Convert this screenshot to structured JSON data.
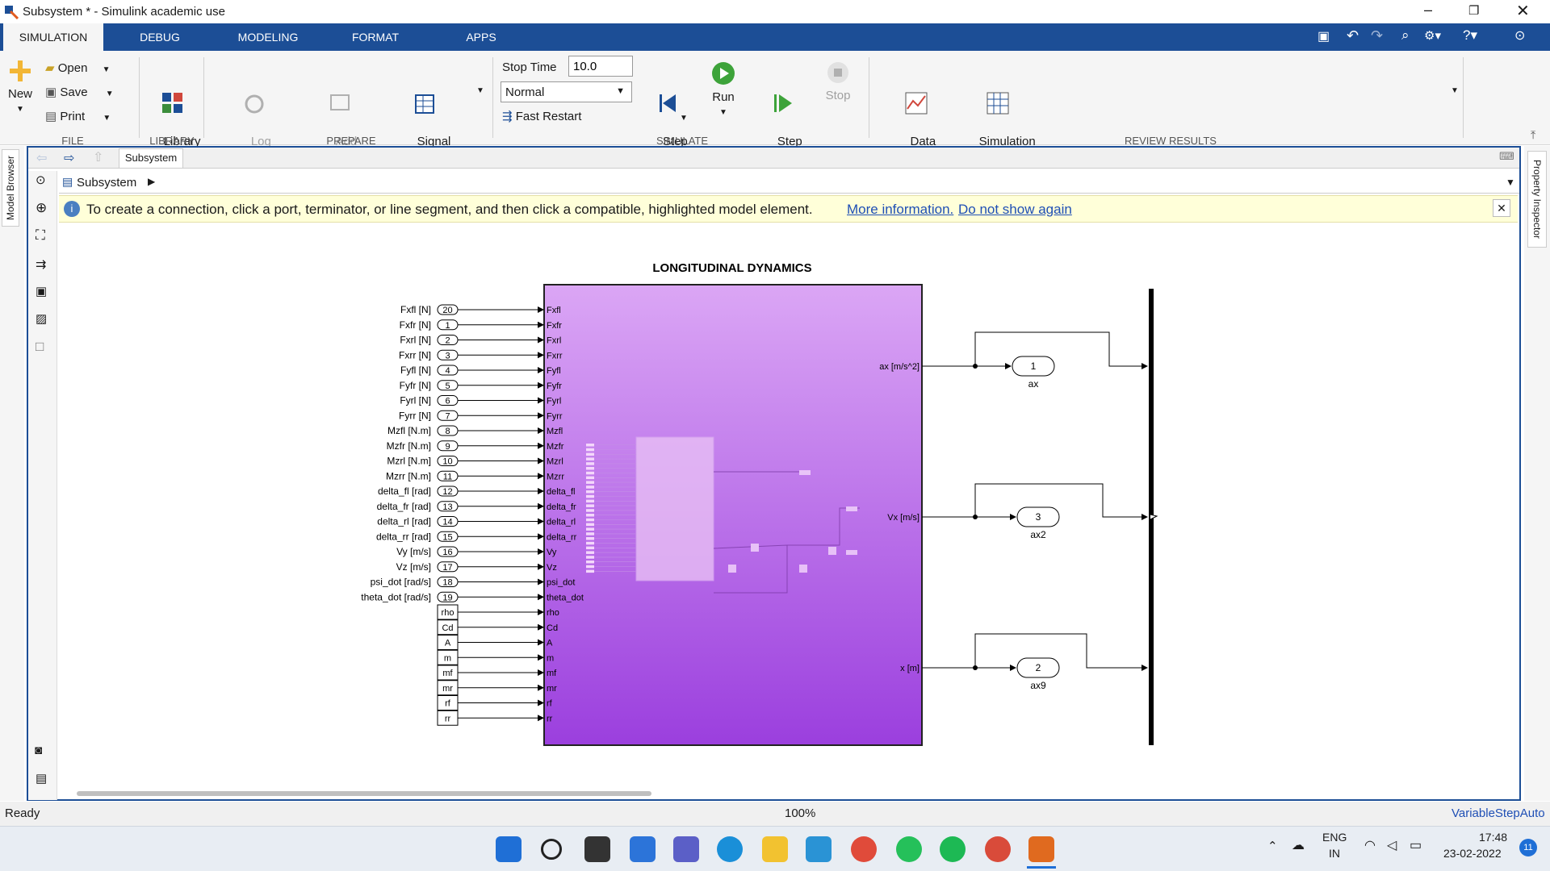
{
  "window": {
    "title": "Subsystem * - Simulink academic use"
  },
  "tabs": [
    "SIMULATION",
    "DEBUG",
    "MODELING",
    "FORMAT",
    "APPS"
  ],
  "ribbon": {
    "new": "New",
    "open": "Open",
    "save": "Save",
    "print": "Print",
    "library": "Library\nBrowser",
    "log_signals": "Log\nSignals",
    "add_viewer": "Add\nViewer",
    "signal_table": "Signal\nTable",
    "stop_time_label": "Stop Time",
    "stop_time_value": "10.0",
    "sim_mode": "Normal",
    "fast_restart": "Fast Restart",
    "step_back": "Step\nBack",
    "run": "Run",
    "step_forward": "Step\nForward",
    "stop": "Stop",
    "data_inspector": "Data\nInspector",
    "sim_manager": "Simulation\nManager",
    "groups": {
      "file": "FILE",
      "library": "LIBRARY",
      "prepare": "PREPARE",
      "simulate": "SIMULATE",
      "review": "REVIEW RESULTS"
    }
  },
  "editor": {
    "model_browser": "Model Browser",
    "property_inspector": "Property Inspector",
    "tab": "Subsystem",
    "address": "Subsystem",
    "info_text": "To create a connection, click a port, terminator, or line segment, and then click a compatible, highlighted model element.",
    "info_more": "More information.",
    "info_dismiss": "Do not show again"
  },
  "diagram": {
    "subsystem_title": "LONGITUDINAL DYNAMICS",
    "inputs": [
      {
        "label": "Fxfl [N]",
        "num": "20",
        "port": "Fxfl"
      },
      {
        "label": "Fxfr [N]",
        "num": "1",
        "port": "Fxfr"
      },
      {
        "label": "Fxrl [N]",
        "num": "2",
        "port": "Fxrl"
      },
      {
        "label": "Fxrr [N]",
        "num": "3",
        "port": "Fxrr"
      },
      {
        "label": "Fyfl [N]",
        "num": "4",
        "port": "Fyfl"
      },
      {
        "label": "Fyfr [N]",
        "num": "5",
        "port": "Fyfr"
      },
      {
        "label": "Fyrl [N]",
        "num": "6",
        "port": "Fyrl"
      },
      {
        "label": "Fyrr [N]",
        "num": "7",
        "port": "Fyrr"
      },
      {
        "label": "Mzfl [N.m]",
        "num": "8",
        "port": "Mzfl"
      },
      {
        "label": "Mzfr [N.m]",
        "num": "9",
        "port": "Mzfr"
      },
      {
        "label": "Mzrl [N.m]",
        "num": "10",
        "port": "Mzrl"
      },
      {
        "label": "Mzrr [N.m]",
        "num": "11",
        "port": "Mzrr"
      },
      {
        "label": "delta_fl [rad]",
        "num": "12",
        "port": "delta_fl"
      },
      {
        "label": "delta_fr [rad]",
        "num": "13",
        "port": "delta_fr"
      },
      {
        "label": "delta_rl [rad]",
        "num": "14",
        "port": "delta_rl"
      },
      {
        "label": "delta_rr [rad]",
        "num": "15",
        "port": "delta_rr"
      },
      {
        "label": "Vy [m/s]",
        "num": "16",
        "port": "Vy"
      },
      {
        "label": "Vz [m/s]",
        "num": "17",
        "port": "Vz"
      },
      {
        "label": "psi_dot [rad/s]",
        "num": "18",
        "port": "psi_dot"
      },
      {
        "label": "theta_dot [rad/s]",
        "num": "19",
        "port": "theta_dot"
      }
    ],
    "constants": [
      {
        "label": "rho",
        "port": "rho"
      },
      {
        "label": "Cd",
        "port": "Cd"
      },
      {
        "label": "A",
        "port": "A"
      },
      {
        "label": "m",
        "port": "m"
      },
      {
        "label": "mf",
        "port": "mf"
      },
      {
        "label": "mr",
        "port": "mr"
      },
      {
        "label": "rf",
        "port": "rf"
      },
      {
        "label": "rr",
        "port": "rr"
      }
    ],
    "outputs": [
      {
        "port": "ax [m/s^2]",
        "num": "1",
        "name": "ax"
      },
      {
        "port": "Vx [m/s]",
        "num": "3",
        "name": "ax2"
      },
      {
        "port": "x [m]",
        "num": "2",
        "name": "ax9"
      }
    ]
  },
  "status": {
    "left": "Ready",
    "zoom": "100%",
    "solver": "VariableStepAuto"
  },
  "taskbar": {
    "lang1": "ENG",
    "lang2": "IN",
    "time": "17:48",
    "date": "23-02-2022",
    "badge": "11"
  },
  "colors": {
    "accent": "#1c4e96",
    "subsystem_top": "#dba6f5",
    "subsystem_bottom": "#9b3fde",
    "info_bg": "#ffffd9"
  }
}
